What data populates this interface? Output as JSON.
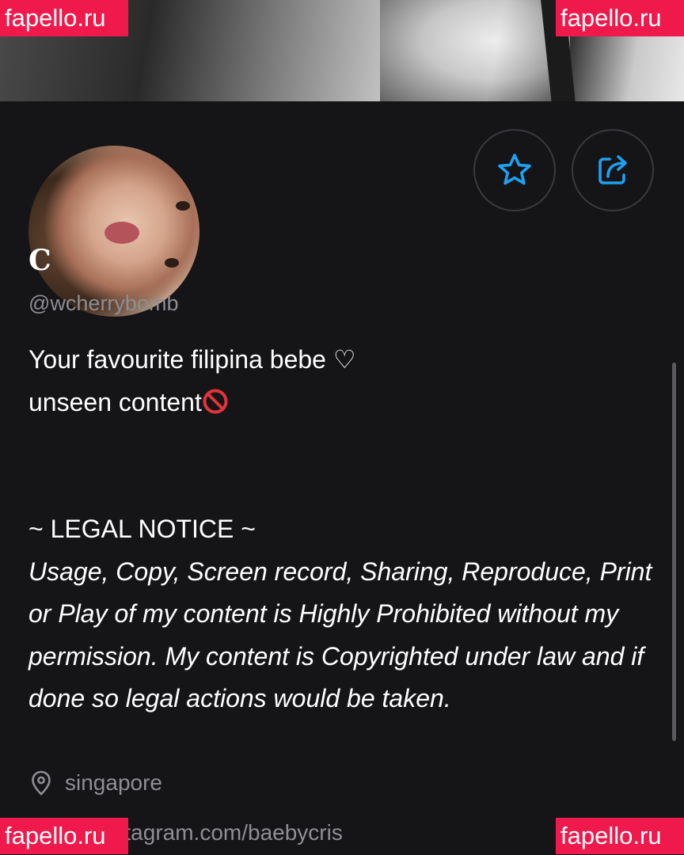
{
  "watermark": "fapello.ru",
  "profile": {
    "display_name": "C",
    "handle": "@wcherrybomb",
    "bio_line1": "Your favourite filipina bebe ♡",
    "bio_line2": "unseen content",
    "legal_heading": "~ LEGAL NOTICE ~",
    "legal_text": "Usage, Copy, Screen record, Sharing, Reproduce, Print or Play of my content is Highly Prohibited without my permission. My content is Copyrighted under law and if done so legal actions would be taken.",
    "location": "singapore",
    "link": "https://Instagram.com/baebycris"
  },
  "actions": {
    "favorite_icon": "star-icon",
    "share_icon": "share-icon"
  },
  "colors": {
    "background": "#151517",
    "accent": "#1ea1f2",
    "muted_text": "#8e8e93",
    "watermark_bg": "#f0194b"
  }
}
